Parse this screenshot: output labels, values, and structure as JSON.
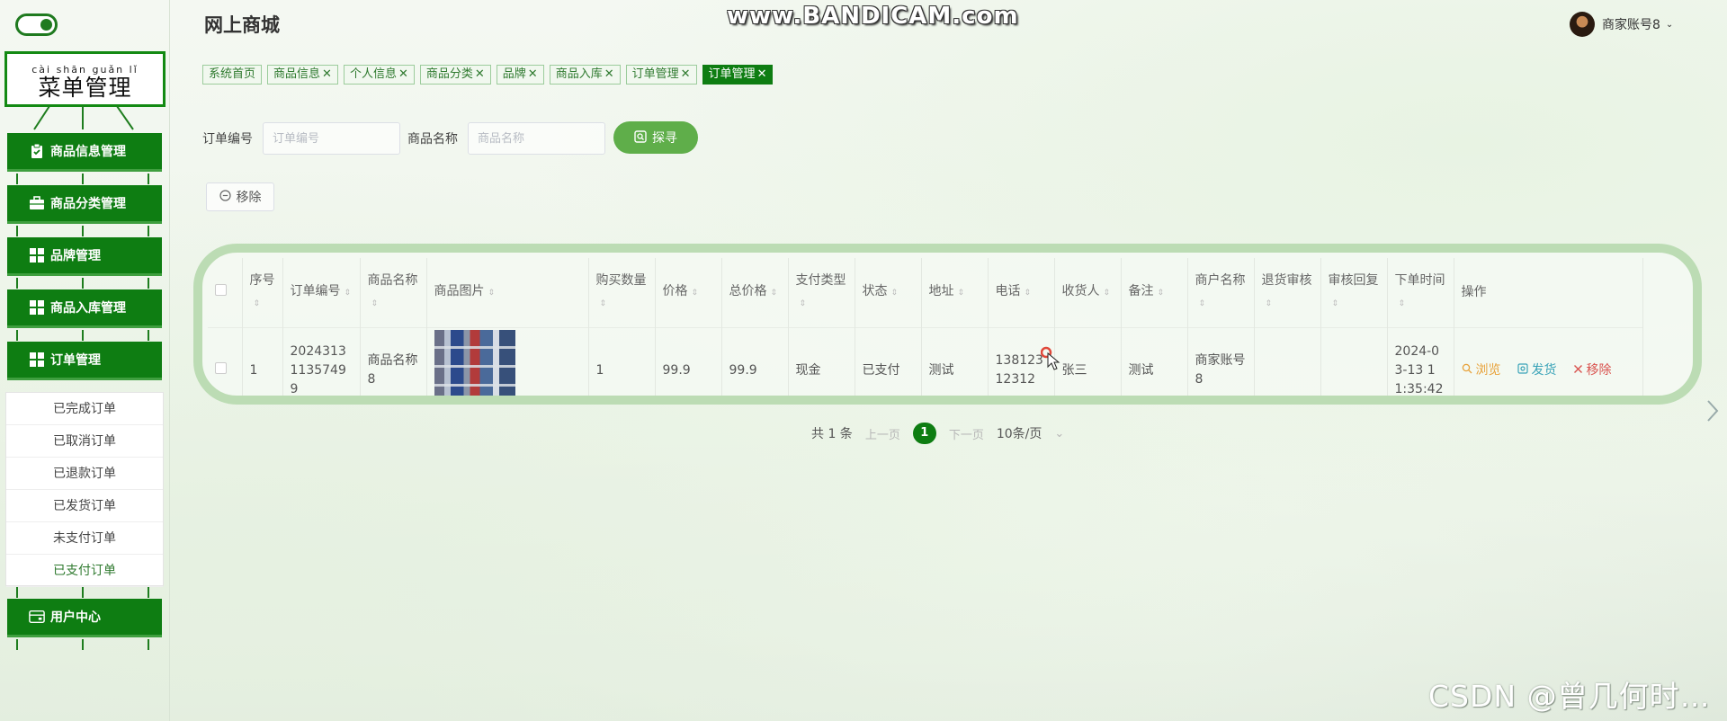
{
  "app": {
    "title": "网上商城",
    "recorder_watermark": "www.BANDICAM.com",
    "blog_watermark": "CSDN @曾几何时…"
  },
  "user": {
    "name": "商家账号8"
  },
  "sidebar": {
    "sign_pinyin": "cài shān guǎn lǐ",
    "sign_title": "菜单管理",
    "items": [
      {
        "label": "商品信息管理",
        "icon": "clipboard-icon"
      },
      {
        "label": "商品分类管理",
        "icon": "briefcase-icon"
      },
      {
        "label": "品牌管理",
        "icon": "grid-icon"
      },
      {
        "label": "商品入库管理",
        "icon": "grid-icon"
      },
      {
        "label": "订单管理",
        "icon": "grid-icon"
      },
      {
        "label": "用户中心",
        "icon": "card-icon"
      }
    ],
    "order_submenu": [
      "已完成订单",
      "已取消订单",
      "已退款订单",
      "已发货订单",
      "未支付订单",
      "已支付订单"
    ]
  },
  "tabs": [
    {
      "label": "系统首页",
      "closable": false,
      "active": false
    },
    {
      "label": "商品信息",
      "closable": true,
      "active": false
    },
    {
      "label": "个人信息",
      "closable": true,
      "active": false
    },
    {
      "label": "商品分类",
      "closable": true,
      "active": false
    },
    {
      "label": "品牌",
      "closable": true,
      "active": false
    },
    {
      "label": "商品入库",
      "closable": true,
      "active": false
    },
    {
      "label": "订单管理",
      "closable": true,
      "active": false
    },
    {
      "label": "订单管理",
      "closable": true,
      "active": true
    }
  ],
  "search": {
    "order_no_label": "订单编号",
    "order_no_placeholder": "订单编号",
    "product_name_label": "商品名称",
    "product_name_placeholder": "商品名称",
    "button_label": "探寻"
  },
  "toolbar": {
    "delete_label": "移除"
  },
  "table": {
    "columns": [
      "序号",
      "订单编号",
      "商品名称",
      "商品图片",
      "购买数量",
      "价格",
      "总价格",
      "支付类型",
      "状态",
      "地址",
      "电话",
      "收货人",
      "备注",
      "商户名称",
      "退货审核",
      "审核回复",
      "下单时间",
      "操作"
    ],
    "rows": [
      {
        "index": "1",
        "order_no": "20243131135749 9",
        "product_name": "商品名称8",
        "quantity": "1",
        "price": "99.9",
        "total": "99.9",
        "pay_type": "现金",
        "status": "已支付",
        "address": "测试",
        "phone": "13812312312",
        "receiver": "张三",
        "remark": "测试",
        "merchant": "商家账号8",
        "return_review": "",
        "review_reply": "",
        "order_time": "2024-03-13 11:35:42"
      }
    ],
    "actions": {
      "view": "浏览",
      "ship": "发货",
      "delete": "移除"
    }
  },
  "pagination": {
    "total_text": "共 1 条",
    "prev": "上一页",
    "current": "1",
    "next": "下一页",
    "page_size": "10条/页"
  },
  "colors": {
    "primary": "#0e7d12",
    "search_button": "#5fae4a",
    "view": "#e8a23a",
    "ship": "#3aa3b8",
    "delete": "#d9534f"
  }
}
